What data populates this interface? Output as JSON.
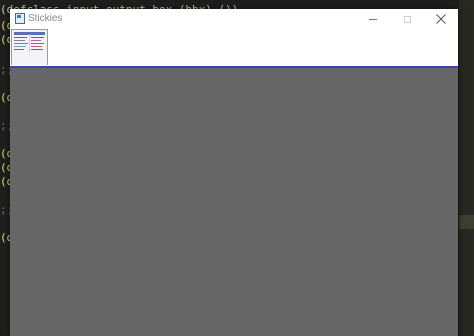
{
  "window": {
    "title": "Stickies",
    "controls": {
      "minimize": "minimize",
      "maximize": "maximize",
      "close": "close"
    }
  },
  "background_editor": {
    "visible_fragments": [
      {
        "text": "(defclass input-output-box (hbx) ())",
        "row": 0
      },
      {
        "text": "(d",
        "row": 1
      },
      {
        "text": "(d",
        "row": 2
      },
      {
        "text": ";;",
        "row": 4
      },
      {
        "text": "(d",
        "row": 6
      },
      {
        "text": ";;",
        "row": 8
      },
      {
        "text": "(d",
        "row": 11
      },
      {
        "text": "(d",
        "row": 12
      },
      {
        "text": "(d",
        "row": 13
      },
      {
        "text": ";;",
        "row": 15
      },
      {
        "text": "(d",
        "row": 17
      }
    ]
  },
  "colors": {
    "accent_line": "#3c46a8",
    "content_bg": "#666666",
    "editor_bg": "#1e1f1c"
  }
}
